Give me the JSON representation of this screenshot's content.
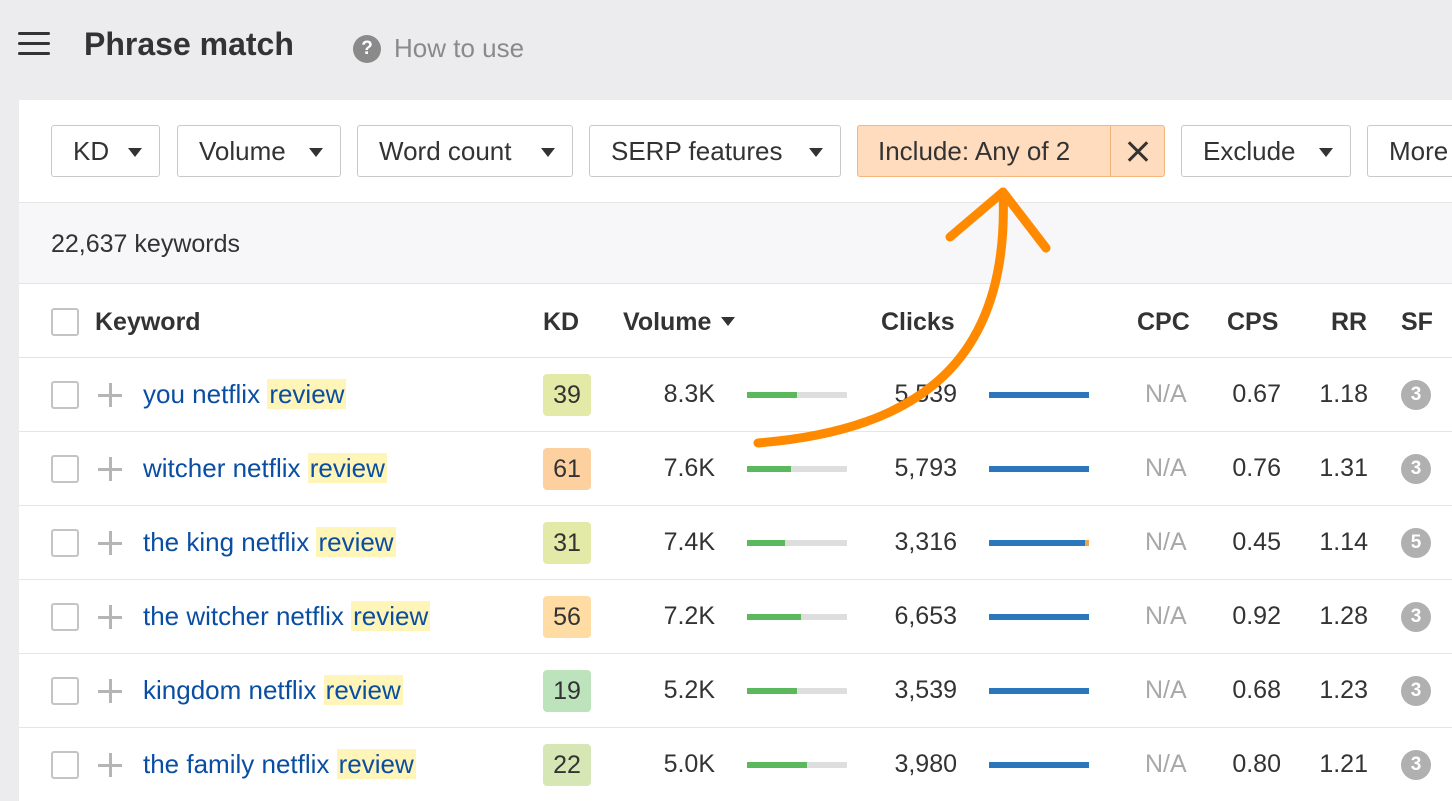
{
  "header": {
    "title": "Phrase match",
    "help_icon": "question-icon",
    "help_label": "How to use"
  },
  "filters": [
    {
      "label": "KD"
    },
    {
      "label": "Volume"
    },
    {
      "label": "Word count"
    },
    {
      "label": "SERP features"
    },
    {
      "label": "Include: Any of 2",
      "active": true
    },
    {
      "label": "Exclude"
    },
    {
      "label": "More"
    }
  ],
  "summary": "22,637 keywords",
  "columns": {
    "keyword": "Keyword",
    "kd": "KD",
    "volume": "Volume",
    "clicks": "Clicks",
    "cpc": "CPC",
    "cps": "CPS",
    "rr": "RR",
    "sf": "SF"
  },
  "rows": [
    {
      "kw_pre": "you netflix",
      "kw_hl": "review",
      "kd": "39",
      "kd_color": "#e3e9a7",
      "volume": "8.3K",
      "volume_share": 0.5,
      "clicks": "5,539",
      "clicks_organic": 1.0,
      "clicks_paid": 0.0,
      "cpc": "N/A",
      "cps": "0.67",
      "rr": "1.18",
      "sf": "3"
    },
    {
      "kw_pre": "witcher netflix",
      "kw_hl": "review",
      "kd": "61",
      "kd_color": "#fdd0a0",
      "volume": "7.6K",
      "volume_share": 0.44,
      "clicks": "5,793",
      "clicks_organic": 1.0,
      "clicks_paid": 0.0,
      "cpc": "N/A",
      "cps": "0.76",
      "rr": "1.31",
      "sf": "3"
    },
    {
      "kw_pre": "the king netflix",
      "kw_hl": "review",
      "kd": "31",
      "kd_color": "#e3e9a7",
      "volume": "7.4K",
      "volume_share": 0.38,
      "clicks": "3,316",
      "clicks_organic": 0.96,
      "clicks_paid": 0.04,
      "cpc": "N/A",
      "cps": "0.45",
      "rr": "1.14",
      "sf": "5"
    },
    {
      "kw_pre": "the witcher netflix",
      "kw_hl": "review",
      "kd": "56",
      "kd_color": "#fedca3",
      "volume": "7.2K",
      "volume_share": 0.54,
      "clicks": "6,653",
      "clicks_organic": 1.0,
      "clicks_paid": 0.0,
      "cpc": "N/A",
      "cps": "0.92",
      "rr": "1.28",
      "sf": "3"
    },
    {
      "kw_pre": "kingdom netflix",
      "kw_hl": "review",
      "kd": "19",
      "kd_color": "#bde3bd",
      "volume": "5.2K",
      "volume_share": 0.5,
      "clicks": "3,539",
      "clicks_organic": 1.0,
      "clicks_paid": 0.0,
      "cpc": "N/A",
      "cps": "0.68",
      "rr": "1.23",
      "sf": "3"
    },
    {
      "kw_pre": "the family netflix",
      "kw_hl": "review",
      "kd": "22",
      "kd_color": "#d6e6b5",
      "volume": "5.0K",
      "volume_share": 0.6,
      "clicks": "3,980",
      "clicks_organic": 1.0,
      "clicks_paid": 0.0,
      "cpc": "N/A",
      "cps": "0.80",
      "rr": "1.21",
      "sf": "3"
    }
  ],
  "colors": {
    "accent_arrow": "#ff8a00",
    "active_filter_bg": "#fedcbd",
    "link": "#0a4ea3",
    "volume_bar": "#5cb85c",
    "clicks_bar": "#2a78bb",
    "keyword_highlight": "#fff5b8"
  }
}
